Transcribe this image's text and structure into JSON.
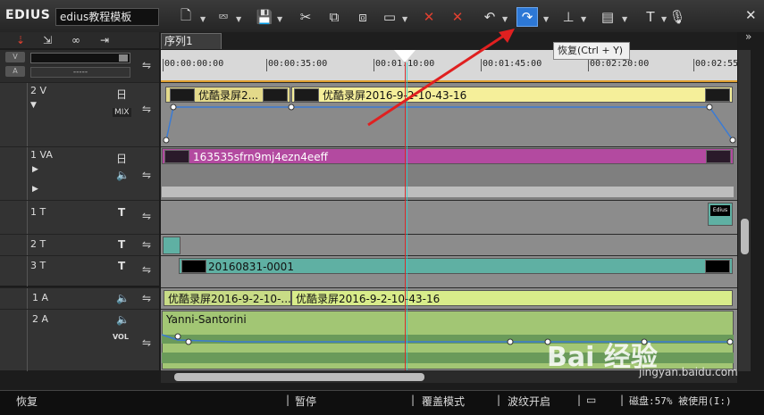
{
  "app": {
    "logo": "EDIUS",
    "project_name": "edius教程模板"
  },
  "toolbar": {
    "icons": [
      "new-document-icon",
      "open-icon",
      "save-icon",
      "cut-icon",
      "copy-icon",
      "paste-icon",
      "clip-icon",
      "delete-icon",
      "ripple-delete-icon",
      "undo-icon",
      "redo-icon",
      "marker-icon",
      "effects-icon",
      "text-icon",
      "microphone-icon"
    ],
    "close_symbol": "✕",
    "collapse_symbol": "»"
  },
  "tooltip": {
    "text": "恢复(Ctrl + Y)"
  },
  "sequence_tab": {
    "label": "序列1"
  },
  "ruler": {
    "ticks": [
      "00:00:00:00",
      "00:00:35:00",
      "00:01:10:00",
      "00:01:45:00",
      "00:02:20:00",
      "00:02:55:"
    ],
    "header_v": "V",
    "header_a": "A",
    "timecode_dashes": "-----"
  },
  "tracks": {
    "t2v": {
      "label": "2 V",
      "mix": "MIX",
      "clip1": "优酷录屏2...",
      "clip2": "优酷录屏2016-9-2-10-43-16"
    },
    "t1va": {
      "label": "1 VA",
      "clip": "163535sfrn9mj4ezn4eeff"
    },
    "t1t": {
      "label": "1 T",
      "thumb_text": "Edius"
    },
    "t2t": {
      "label": "2 T"
    },
    "t3t": {
      "label": "3 T",
      "clip": "20160831-0001"
    },
    "t1a": {
      "label": "1 A",
      "clip1": "优酷录屏2016-9-2-10-...",
      "clip2": "优酷录屏2016-9-2-10-43-16"
    },
    "t2a": {
      "label": "2 A",
      "vol": "VOL",
      "clip": "Yanni-Santorini"
    }
  },
  "status": {
    "restore": "恢复",
    "pause": "暂停",
    "overwrite": "覆盖模式",
    "ripple": "波纹开启",
    "disk": "磁盘:57% 被使用(I:)"
  },
  "colors": {
    "video_clip": "#f5ef9a",
    "va_clip": "#b34aa0",
    "title_clip": "#5fb0a3",
    "audio_clip": "#d8ec8a",
    "audio_wave": "#8fbf6a",
    "ruler_accent": "#e0a030",
    "redo_selected": "#2d78d6"
  },
  "watermark": {
    "text": "Bai 经验",
    "sub": "jingyan.baidu.com"
  }
}
